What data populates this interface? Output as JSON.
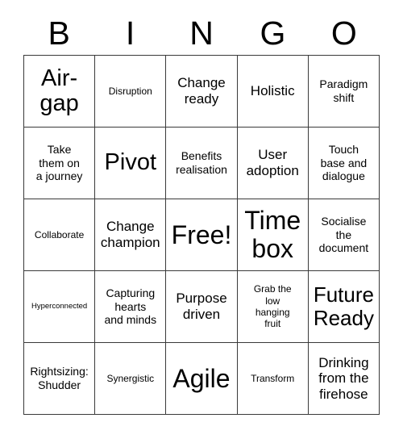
{
  "card": {
    "title_letters": [
      "B",
      "I",
      "N",
      "G",
      "O"
    ],
    "columns": 5,
    "rows": 5,
    "free_space": "Free!",
    "border_color": "#3a3a3a",
    "text_color": "#000000",
    "background_color": "#ffffff",
    "cells": [
      {
        "text": "Air-\ngap",
        "size": "xl"
      },
      {
        "text": "Disruption",
        "size": "xs"
      },
      {
        "text": "Change\nready",
        "size": "md"
      },
      {
        "text": "Holistic",
        "size": "md"
      },
      {
        "text": "Paradigm\nshift",
        "size": "sm"
      },
      {
        "text": "Take\nthem on\na journey",
        "size": "sm"
      },
      {
        "text": "Pivot",
        "size": "xl"
      },
      {
        "text": "Benefits\nrealisation",
        "size": "sm"
      },
      {
        "text": "User\nadoption",
        "size": "md"
      },
      {
        "text": "Touch\nbase and\ndialogue",
        "size": "sm"
      },
      {
        "text": "Collaborate",
        "size": "xs"
      },
      {
        "text": "Change\nchampion",
        "size": "md"
      },
      {
        "text": "Free!",
        "size": "xxl"
      },
      {
        "text": "Time\nbox",
        "size": "xxl"
      },
      {
        "text": "Socialise\nthe\ndocument",
        "size": "sm"
      },
      {
        "text": "Hyperconnected",
        "size": "xxs"
      },
      {
        "text": "Capturing\nhearts\nand minds",
        "size": "sm"
      },
      {
        "text": "Purpose\ndriven",
        "size": "md"
      },
      {
        "text": "Grab the\nlow\nhanging\nfruit",
        "size": "xs"
      },
      {
        "text": "Future\nReady",
        "size": "lg"
      },
      {
        "text": "Rightsizing:\nShudder",
        "size": "sm"
      },
      {
        "text": "Synergistic",
        "size": "xs"
      },
      {
        "text": "Agile",
        "size": "xxl"
      },
      {
        "text": "Transform",
        "size": "xs"
      },
      {
        "text": "Drinking\nfrom the\nfirehose",
        "size": "md"
      }
    ]
  }
}
